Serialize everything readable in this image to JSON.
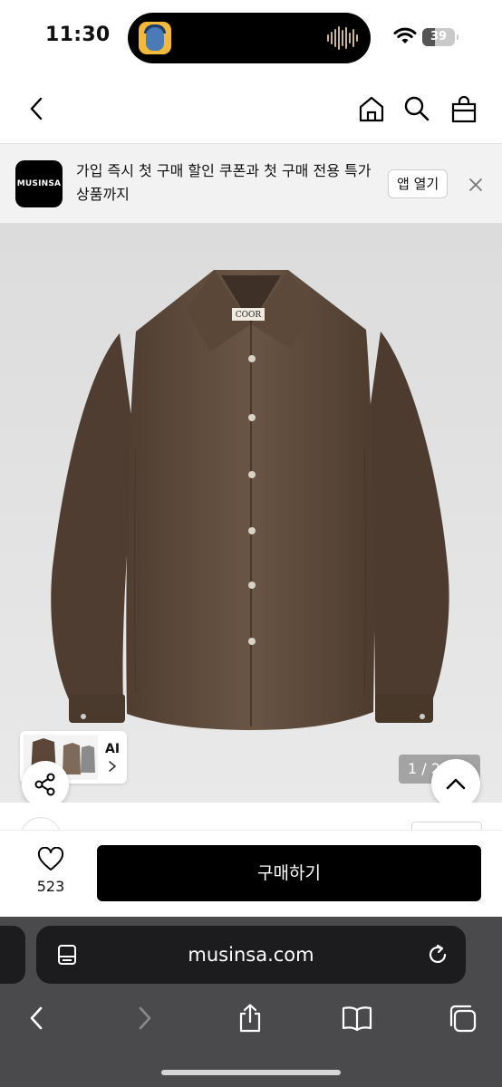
{
  "status_bar": {
    "time": "11:30",
    "battery": "39"
  },
  "banner": {
    "logo_text": "MUSINSA",
    "message": "가입 즉시 첫 구매 할인 쿠폰과 첫 구매 전용 특가 상품까지",
    "open_app_label": "앱 열기"
  },
  "product": {
    "brand_tag": "COOR",
    "ai_label": "AI",
    "page_counter": "1 / 2"
  },
  "purchase": {
    "like_count": "523",
    "buy_label": "구매하기"
  },
  "browser": {
    "url": "musinsa.com"
  },
  "colors": {
    "shirt": "#5e4a3a",
    "accent": "#000000",
    "banner_bg": "#f2f2f2"
  }
}
